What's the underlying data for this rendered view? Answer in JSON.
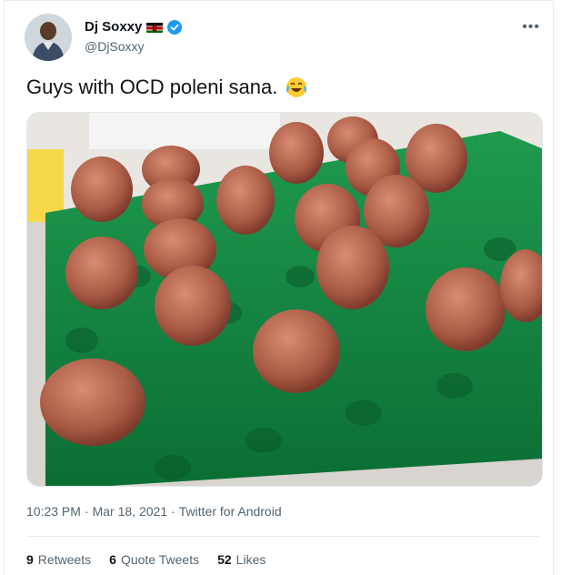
{
  "user": {
    "display_name": "Dj Soxxy",
    "handle": "@DjSoxxy",
    "flag_icon": "kenya-flag-icon",
    "verified_icon": "verified-badge-icon",
    "verified_color": "#1d9bf0"
  },
  "menu": {
    "more_label": "•••"
  },
  "tweet": {
    "text": "Guys with OCD poleni sana.",
    "emoji": "face-with-tears-of-joy-icon"
  },
  "media": {
    "image_name": "eggs-in-green-tray-photo"
  },
  "meta": {
    "time": "10:23 PM",
    "sep1": "·",
    "date": "Mar 18, 2021",
    "sep2": "·",
    "source": "Twitter for Android"
  },
  "stats": {
    "retweets_count": "9",
    "retweets_label": "Retweets",
    "quotes_count": "6",
    "quotes_label": "Quote Tweets",
    "likes_count": "52",
    "likes_label": "Likes"
  }
}
